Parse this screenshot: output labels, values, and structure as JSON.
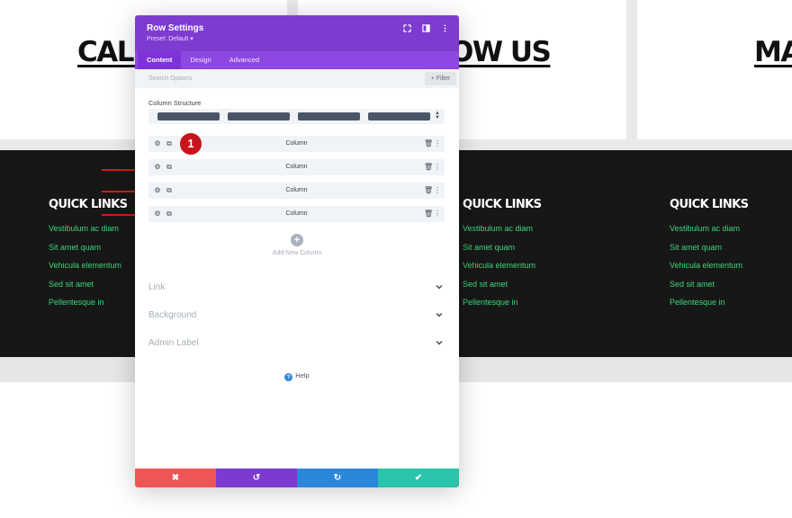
{
  "background": {
    "headings": [
      "CALL",
      "OW US",
      "MA"
    ],
    "footer_columns": [
      {
        "title": "QUICK LINKS",
        "links": [
          "Vestibulum ac diam",
          "Sit amet quam",
          "Vehicula elementum",
          "Sed sit amet",
          "Pellentesque in"
        ]
      },
      {
        "title": "QUICK LINKS",
        "links": [
          "Vestibulum ac diam",
          "Sit amet quam",
          "Vehicula elementum",
          "Sed sit amet",
          "Pellentesque in"
        ]
      },
      {
        "title": "QUICK LINKS",
        "links": [
          "Vestibulum ac diam",
          "Sit amet quam",
          "Vehicula elementum",
          "Sed sit amet",
          "Pellentesque in"
        ]
      }
    ]
  },
  "modal": {
    "title": "Row Settings",
    "preset": "Preset: Default ▾",
    "tabs": [
      "Content",
      "Design",
      "Advanced"
    ],
    "active_tab": "Content",
    "search_placeholder": "Search Options",
    "filter_label": "+ Filter",
    "column_structure_label": "Column Structure",
    "columns": [
      {
        "label": "Column"
      },
      {
        "label": "Column"
      },
      {
        "label": "Column"
      },
      {
        "label": "Column"
      }
    ],
    "badge_number": "1",
    "add_column_label": "Add New Column",
    "toggles": [
      "Link",
      "Background",
      "Admin Label"
    ],
    "help_label": "Help",
    "footer_icons": {
      "cancel": "✖",
      "undo": "↺",
      "redo": "↻",
      "save": "✔"
    }
  },
  "colors": {
    "header_purple": "#7e3bd0",
    "tab_bar_purple": "#8e47e2",
    "link_green": "#3fd67a",
    "annotation_red": "#d21b1b",
    "cancel_red": "#ef5555",
    "redo_blue": "#2b87da",
    "save_teal": "#29c4a9"
  }
}
